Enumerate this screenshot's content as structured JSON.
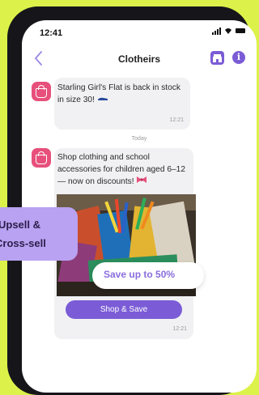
{
  "status_bar": {
    "time": "12:41"
  },
  "header": {
    "title": "Clotheirs",
    "back_icon": "chevron-left-icon",
    "store_icon": "store-icon",
    "info_icon": "info-icon",
    "accent_color": "#7b5cd6"
  },
  "messages": [
    {
      "text": "Starling Girl's Flat is back in stock in size 30!",
      "emoji": "flat-shoe-emoji",
      "time": "12:21"
    },
    {
      "text": "Shop clothing and school accessories for children aged 6–12 — now on discounts!",
      "emoji": "bow-emoji",
      "time": "12:21"
    }
  ],
  "day_separator": "Today",
  "promo": {
    "badge": "Save up to 50%",
    "button": "Shop & Save"
  },
  "overlay_tag": {
    "line1": "Upsell &",
    "line2": "Cross-sell"
  },
  "colors": {
    "background": "#dcf24a",
    "avatar": "#e7507b",
    "tag": "#b9a2f1"
  }
}
